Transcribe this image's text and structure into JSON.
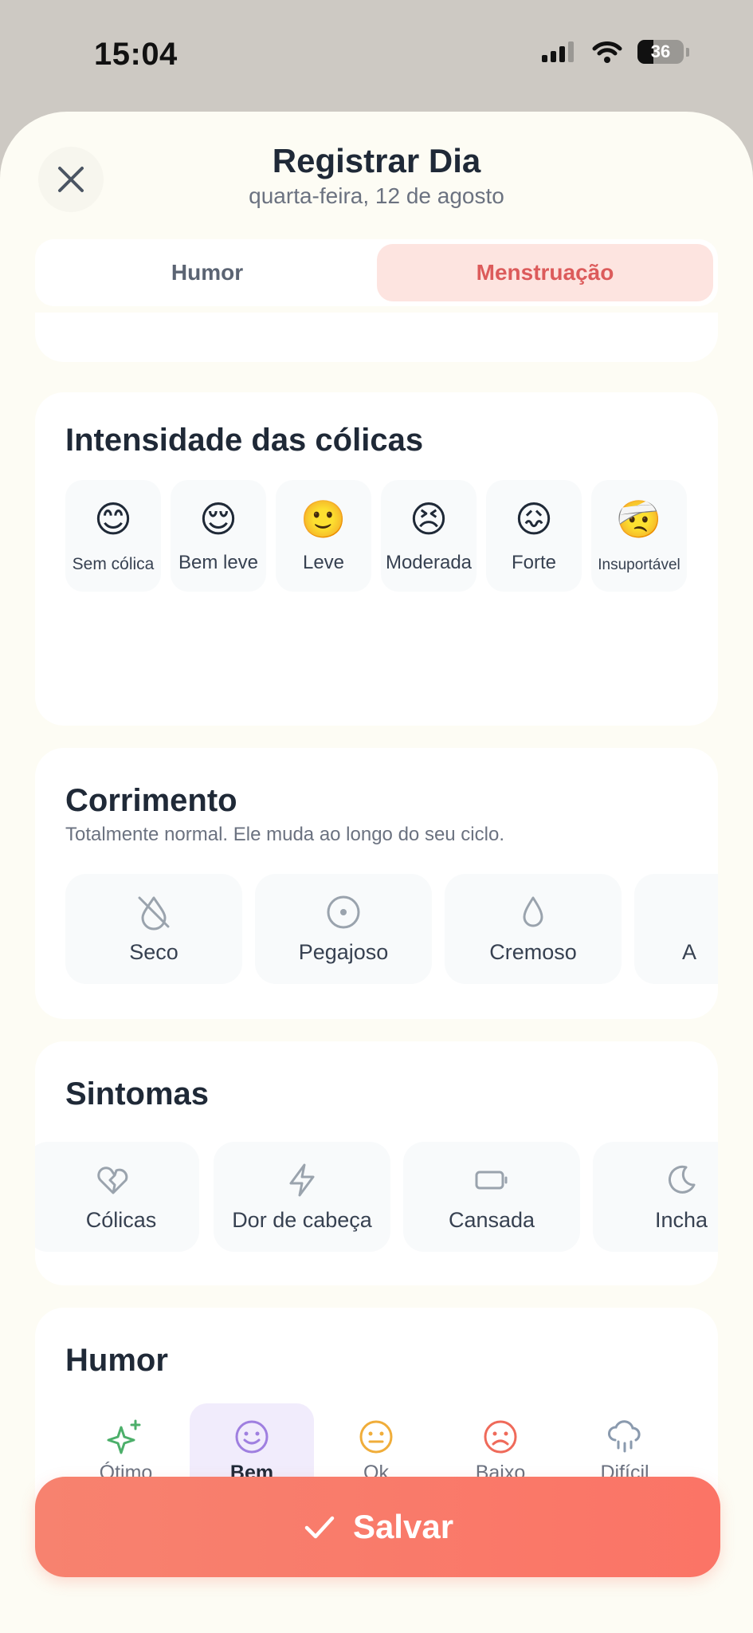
{
  "status_bar": {
    "time": "15:04",
    "battery": "36"
  },
  "header": {
    "title": "Registrar Dia",
    "subtitle": "quarta-feira, 12 de agosto"
  },
  "tabs": [
    {
      "label": "Humor",
      "selected": false
    },
    {
      "label": "Menstruação",
      "selected": true
    }
  ],
  "cramps": {
    "title": "Intensidade das cólicas",
    "options": [
      {
        "emoji": "😊",
        "label": "Sem cólica"
      },
      {
        "emoji": "😌",
        "label": "Bem leve"
      },
      {
        "emoji": "🙂",
        "label": "Leve"
      },
      {
        "emoji": "😣",
        "label": "Moderada"
      },
      {
        "emoji": "😖",
        "label": "Forte"
      },
      {
        "emoji": "🤕",
        "label": "Insuportável"
      }
    ]
  },
  "discharge": {
    "title": "Corrimento",
    "subtitle": "Totalmente normal. Ele muda ao longo do seu ciclo.",
    "options": [
      {
        "icon": "dry-icon",
        "label": "Seco"
      },
      {
        "icon": "sticky-icon",
        "label": "Pegajoso"
      },
      {
        "icon": "drop-icon",
        "label": "Cremoso"
      },
      {
        "icon": "partial-icon",
        "label": "A"
      }
    ]
  },
  "symptoms": {
    "title": "Sintomas",
    "options": [
      {
        "icon": "broken-heart-icon",
        "label": "Cólicas"
      },
      {
        "icon": "lightning-icon",
        "label": "Dor de cabeça"
      },
      {
        "icon": "battery-low-icon",
        "label": "Cansada"
      },
      {
        "icon": "moon-icon",
        "label": "Incha"
      }
    ]
  },
  "mood": {
    "title": "Humor",
    "selected": "Bem",
    "options": [
      {
        "icon": "sparkles-icon",
        "label": "Ótimo",
        "color": "#4caf6a"
      },
      {
        "icon": "smile-icon",
        "label": "Bem",
        "color": "#9f7fe0"
      },
      {
        "icon": "neutral-icon",
        "label": "Ok",
        "color": "#f0ad3a"
      },
      {
        "icon": "frown-icon",
        "label": "Baixo",
        "color": "#ef6a5a"
      },
      {
        "icon": "cloud-rain-icon",
        "label": "Difícil",
        "color": "#8a9aae"
      }
    ]
  },
  "save_button": {
    "label": "Salvar"
  },
  "colors": {
    "accent": "#fb7a6a",
    "selected_tab_bg": "#fde4e0",
    "selected_tab_text": "#dc5b5b",
    "sheet_bg": "#fdfcf4"
  }
}
